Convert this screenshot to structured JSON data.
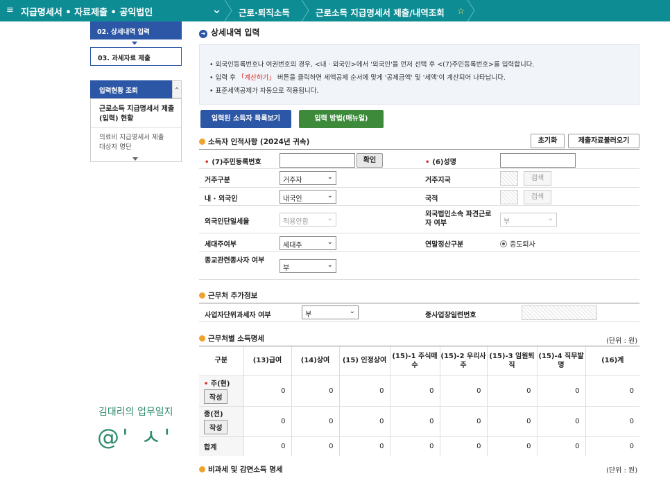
{
  "header": {
    "menu_icon": "≡",
    "title": "지급명세서 • 자료제출 • 공익법인",
    "crumb1": "근로·퇴직소득",
    "crumb2": "근로소득 지급명세서 제출/내역조회",
    "star": "☆"
  },
  "sidebar": {
    "step2": "02. 상세내역 입력",
    "step3": "03. 과세자료 제출",
    "status_title": "입력현황 조회",
    "status_up": "^",
    "status_item1": "근로소득 지급명세서 제출(입력) 현황",
    "status_item2": "의료비 지급명세서 제출 대상자 명단"
  },
  "watermark": {
    "line1": "김대리의 업무일지",
    "line2": "@' ㅅ'"
  },
  "page": {
    "title": "상세내역 입력",
    "title_icon": "➜"
  },
  "info": {
    "l1": "외국인등록번호나 여권번호의 경우, <내 · 외국인>에서 '외국인'을 먼저 선택 후 <(7)주민등록번호>를 입력합니다.",
    "l2a": "입력 후 ",
    "l2b": "「계산하기」",
    "l2c": " 버튼을 클릭하면 세액공제 순서에 맞게 '공제금액' 및 '세액'이 계산되어 나타납니다.",
    "l3": "표준세액공제가 자동으로 적용됩니다."
  },
  "buttons": {
    "list": "입력된 소득자 목록보기",
    "manual": "입력 방법(매뉴얼)",
    "reset": "초기화",
    "load": "제출자료불러오기",
    "confirm": "확인",
    "search1": "검색",
    "search2": "검색"
  },
  "person": {
    "section": "소득자 인적사항 (2024년 귀속)",
    "rrn_label": "(7)주민등록번호",
    "name_label": "(6)성명",
    "residence_label": "거주구분",
    "residence_value": "거주자",
    "region_label": "거주지국",
    "nation_type_label": "내 · 외국인",
    "nation_type_value": "내국인",
    "country_label": "국적",
    "flat_tax_label": "외국인단일세율",
    "flat_tax_value": "적용안함",
    "dispatch_label": "외국법인소속 파견근로자 여부",
    "dispatch_value": "부",
    "head_label": "세대주여부",
    "head_value": "세대주",
    "settle_label": "연말정산구분",
    "settle_value": "중도퇴사",
    "religion_label": "종교관련종사자 여부",
    "religion_value": "부"
  },
  "workplace": {
    "section": "근무처 추가정보",
    "unit_tax_label": "사업자단위과세자 여부",
    "unit_tax_value": "부",
    "branch_label": "종사업장일련번호"
  },
  "income": {
    "section": "근무처별 소득명세",
    "unit": "(단위 : 원)",
    "headers": [
      "구분",
      "(13)급여",
      "(14)상여",
      "(15) 인정상여",
      "(15)-1 주식매수",
      "(15)-2 우리사주",
      "(15)-3 임원퇴직",
      "(15)-4 직무발명",
      "(16)계"
    ],
    "rows": [
      {
        "label": "주(현)",
        "btn": "작성",
        "values": [
          "0",
          "0",
          "0",
          "0",
          "0",
          "0",
          "0",
          "0"
        ]
      },
      {
        "label": "종(전)",
        "btn": "작성",
        "values": [
          "0",
          "0",
          "0",
          "0",
          "0",
          "0",
          "0",
          "0"
        ]
      },
      {
        "label": "합계",
        "values": [
          "0",
          "0",
          "0",
          "0",
          "0",
          "0",
          "0",
          "0"
        ]
      }
    ]
  },
  "nontax": {
    "section": "비과세 및 감면소득 명세",
    "unit": "(단위 : 원)"
  }
}
